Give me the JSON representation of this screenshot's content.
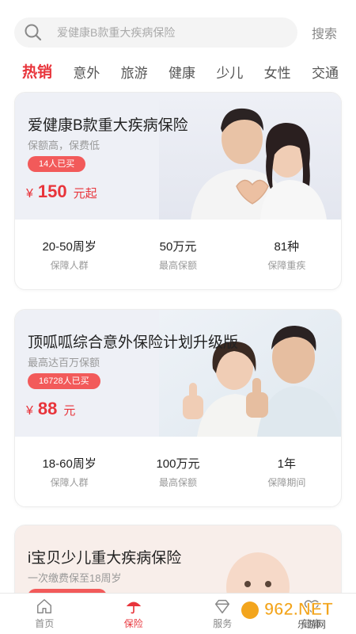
{
  "search": {
    "placeholder": "爱健康B款重大疾病保险",
    "button": "搜索",
    "icon": "search-icon"
  },
  "tabs": [
    {
      "label": "热销",
      "active": true
    },
    {
      "label": "意外"
    },
    {
      "label": "旅游"
    },
    {
      "label": "健康"
    },
    {
      "label": "少儿"
    },
    {
      "label": "女性"
    },
    {
      "label": "交通"
    }
  ],
  "products": [
    {
      "title": "爱健康B款重大疾病保险",
      "subtitle": "保额高，保费低",
      "badge": "14人已买",
      "currency": "¥",
      "price": "150",
      "price_unit": "元起",
      "stats": [
        {
          "value": "20-50周岁",
          "label": "保障人群"
        },
        {
          "value": "50万元",
          "label": "最高保额"
        },
        {
          "value": "81种",
          "label": "保障重疾"
        }
      ]
    },
    {
      "title": "顶呱呱综合意外保险计划升级版",
      "subtitle": "最高达百万保额",
      "badge": "16728人已买",
      "currency": "¥",
      "price": "88",
      "price_unit": "元",
      "stats": [
        {
          "value": "18-60周岁",
          "label": "保障人群"
        },
        {
          "value": "100万元",
          "label": "最高保额"
        },
        {
          "value": "1年",
          "label": "保障期间"
        }
      ]
    },
    {
      "title": "i宝贝少儿重大疾病保险",
      "subtitle": "一次缴费保至18周岁"
    }
  ],
  "bottom_nav": [
    {
      "label": "首页",
      "icon": "home-icon"
    },
    {
      "label": "保险",
      "icon": "umbrella-icon",
      "active": true
    },
    {
      "label": "服务",
      "icon": "diamond-icon"
    },
    {
      "label": "健康",
      "icon": "heart-icon"
    }
  ],
  "watermark": {
    "text": "962.NET",
    "sub": "乐游网"
  },
  "colors": {
    "accent": "#e8343b",
    "badge": "#f25a5a",
    "card_top": "#eef0f6",
    "card3_top": "#f8eeea"
  }
}
